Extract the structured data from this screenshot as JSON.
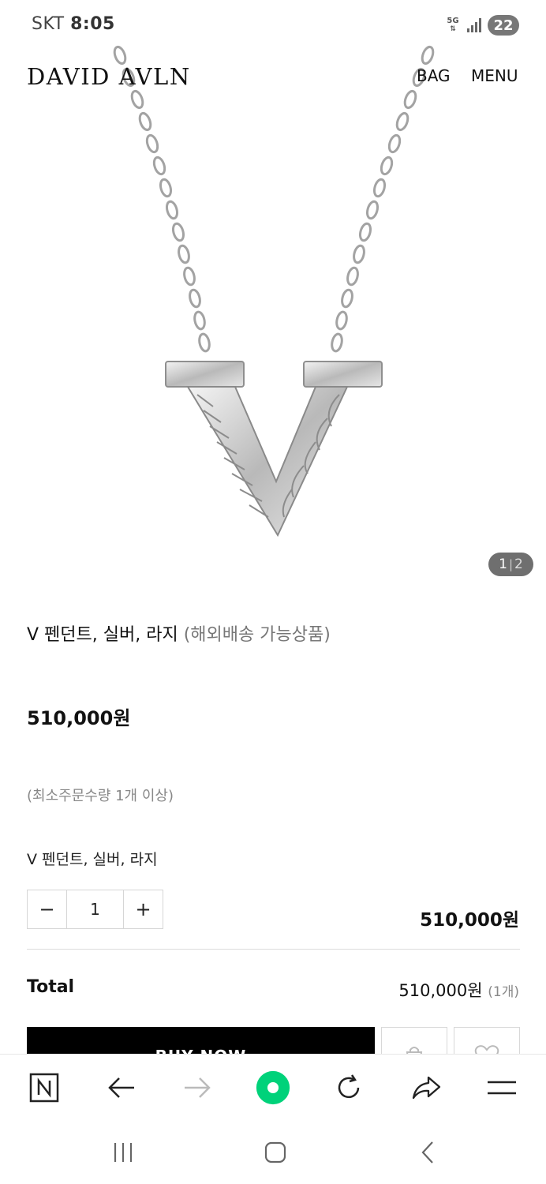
{
  "status_bar": {
    "carrier": "SKT",
    "time": "8:05",
    "network": "5G",
    "battery": "22"
  },
  "header": {
    "brand": "DAVID AVLN",
    "bag_label": "BAG",
    "menu_label": "MENU"
  },
  "gallery": {
    "current": "1",
    "separator": "|",
    "total": "2"
  },
  "product": {
    "name": "V 펜던트, 실버, 라지",
    "shipping_note": "(해외배송 가능상품)",
    "price": "510,000원",
    "min_order": "(최소주문수량 1개 이상)"
  },
  "option": {
    "name": "V 펜던트, 실버, 라지",
    "minus_label": "−",
    "quantity": "1",
    "plus_label": "+",
    "price": "510,000원"
  },
  "total": {
    "label": "Total",
    "value": "510,000원",
    "count": "(1개)"
  },
  "actions": {
    "buy_now_label": "BUY NOW"
  },
  "icons": {
    "browser_bar": [
      "naver-home-icon",
      "back-arrow-icon",
      "forward-arrow-icon",
      "green-dot-icon",
      "refresh-icon",
      "share-icon",
      "hamburger-menu-icon"
    ],
    "system_nav": [
      "recent-apps-icon",
      "home-icon",
      "back-icon"
    ],
    "product_actions": [
      "shopping-bag-icon",
      "heart-icon"
    ]
  },
  "colors": {
    "accent_green": "#00d27a",
    "buy_button": "#000000",
    "counter_badge": "#6f6f6f"
  }
}
